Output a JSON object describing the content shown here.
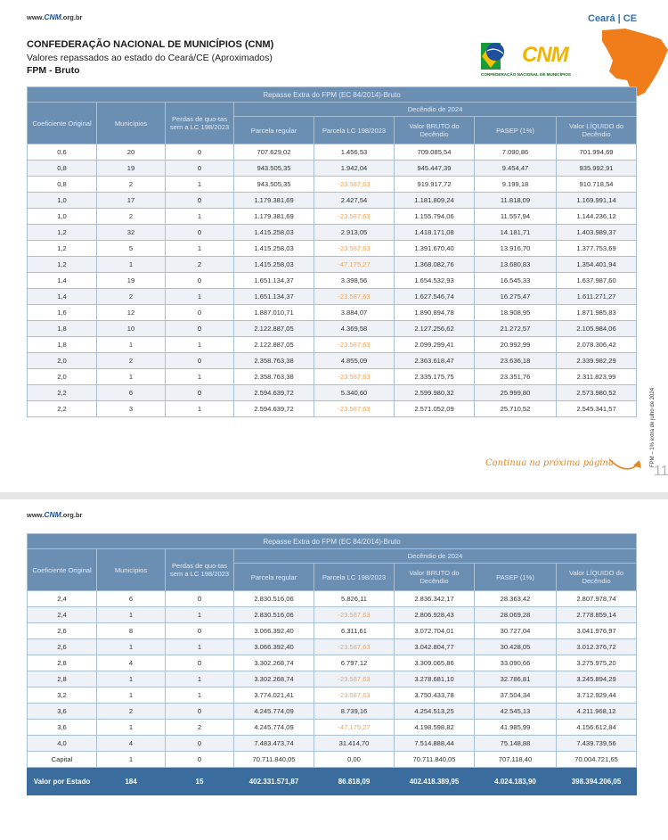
{
  "page1": {
    "site": "www.CNM.org.br",
    "state_label": "Ceará | CE",
    "title": "CONFEDERAÇÃO NACIONAL DE MUNICÍPIOS (CNM)",
    "subtitle": "Valores repassados ao estado do Ceará/CE (Aproximados)",
    "subtitle2": "FPM - Bruto",
    "logo_text": "CNM",
    "logo_sub": "CONFEDERAÇÃO NACIONAL DE MUNICÍPIOS",
    "continue_text": "Continua na próxima página",
    "page_number": "11",
    "side_text": "FPM – 1% extra de julho de 2024"
  },
  "page2": {
    "site": "www.CNM.org.br"
  },
  "table": {
    "caption": "Repasse Extra do FPM (EC 84/2014)-Bruto",
    "group_header": "Decêndio de 2024",
    "headers": {
      "coef": "Coeficiente Original",
      "mun": "Municípios",
      "perdas": "Perdas de quo-tas sem a LC 198/2023",
      "regular": "Parcela regular",
      "lc": "Parcela LC 198/2023",
      "bruto": "Valor BRUTO do Decêndio",
      "pasep": "PASEP (1%)",
      "liquido": "Valor LÍQUIDO do Decêndio"
    }
  },
  "rows1": [
    [
      "0,6",
      "20",
      "0",
      "707.629,02",
      "1.456,53",
      "709.085,54",
      "7.090,86",
      "701.994,69"
    ],
    [
      "0,8",
      "19",
      "0",
      "943.505,35",
      "1.942,04",
      "945.447,39",
      "9.454,47",
      "935.992,91"
    ],
    [
      "0,8",
      "2",
      "1",
      "943.505,35",
      "-23.587,63",
      "919.917,72",
      "9.199,18",
      "910.718,54"
    ],
    [
      "1,0",
      "17",
      "0",
      "1.179.381,69",
      "2.427,54",
      "1.181.809,24",
      "11.818,09",
      "1.169.991,14"
    ],
    [
      "1,0",
      "2",
      "1",
      "1.179.381,69",
      "-23.587,63",
      "1.155.794,06",
      "11.557,94",
      "1.144.236,12"
    ],
    [
      "1,2",
      "32",
      "0",
      "1.415.258,03",
      "2.913,05",
      "1.418.171,08",
      "14.181,71",
      "1.403.989,37"
    ],
    [
      "1,2",
      "5",
      "1",
      "1.415.258,03",
      "-23.587,63",
      "1.391.670,40",
      "13.916,70",
      "1.377.753,69"
    ],
    [
      "1,2",
      "1",
      "2",
      "1.415.258,03",
      "-47.175,27",
      "1.368.082,76",
      "13.680,83",
      "1.354.401,94"
    ],
    [
      "1,4",
      "19",
      "0",
      "1.651.134,37",
      "3.398,56",
      "1.654.532,93",
      "16.545,33",
      "1.637.987,60"
    ],
    [
      "1,4",
      "2",
      "1",
      "1.651.134,37",
      "-23.587,63",
      "1.627.546,74",
      "16.275,47",
      "1.611.271,27"
    ],
    [
      "1,6",
      "12",
      "0",
      "1.887.010,71",
      "3.884,07",
      "1.890.894,78",
      "18.908,95",
      "1.871.985,83"
    ],
    [
      "1,8",
      "10",
      "0",
      "2.122.887,05",
      "4.369,58",
      "2.127.256,62",
      "21.272,57",
      "2.105.984,06"
    ],
    [
      "1,8",
      "1",
      "1",
      "2.122.887,05",
      "-23.587,63",
      "2.099.299,41",
      "20.992,99",
      "2.078.306,42"
    ],
    [
      "2,0",
      "2",
      "0",
      "2.358.763,38",
      "4.855,09",
      "2.363.618,47",
      "23.636,18",
      "2.339.982,29"
    ],
    [
      "2,0",
      "1",
      "1",
      "2.358.763,38",
      "-23.587,63",
      "2.335.175,75",
      "23.351,76",
      "2.311.823,99"
    ],
    [
      "2,2",
      "6",
      "0",
      "2.594.639,72",
      "5.340,60",
      "2.599.980,32",
      "25.999,80",
      "2.573.980,52"
    ],
    [
      "2,2",
      "3",
      "1",
      "2.594.639,72",
      "-23.587,63",
      "2.571.052,09",
      "25.710,52",
      "2.545.341,57"
    ]
  ],
  "rows2": [
    [
      "2,4",
      "6",
      "0",
      "2.830.516,06",
      "5.826,11",
      "2.836.342,17",
      "28.363,42",
      "2.807.978,74"
    ],
    [
      "2,4",
      "1",
      "1",
      "2.830.516,06",
      "-23.587,63",
      "2.806.928,43",
      "28.069,28",
      "2.778.859,14"
    ],
    [
      "2,6",
      "8",
      "0",
      "3.066.392,40",
      "6.311,61",
      "3.072.704,01",
      "30.727,04",
      "3.041.976,97"
    ],
    [
      "2,6",
      "1",
      "1",
      "3.066.392,40",
      "-23.587,63",
      "3.042.804,77",
      "30.428,05",
      "3.012.376,72"
    ],
    [
      "2,8",
      "4",
      "0",
      "3.302.268,74",
      "6.797,12",
      "3.309.065,86",
      "33.090,66",
      "3.275.975,20"
    ],
    [
      "2,8",
      "1",
      "1",
      "3.302.268,74",
      "-23.587,63",
      "3.278.681,10",
      "32.786,81",
      "3.245.894,29"
    ],
    [
      "3,2",
      "1",
      "1",
      "3.774.021,41",
      "-23.587,63",
      "3.750.433,78",
      "37.504,34",
      "3.712.929,44"
    ],
    [
      "3,6",
      "2",
      "0",
      "4.245.774,09",
      "8.739,16",
      "4.254.513,25",
      "42.545,13",
      "4.211.968,12"
    ],
    [
      "3,6",
      "1",
      "2",
      "4.245.774,09",
      "-47.175,27",
      "4.198.598,82",
      "41.985,99",
      "4.156.612,84"
    ],
    [
      "4,0",
      "4",
      "0",
      "7.483.473,74",
      "31.414,70",
      "7.514.888,44",
      "75.148,88",
      "7.439.739,56"
    ],
    [
      "Capital",
      "1",
      "0",
      "70.711.840,05",
      "0,00",
      "70.711.840,05",
      "707.118,40",
      "70.004.721,65"
    ]
  ],
  "total": [
    "Valor por Estado",
    "184",
    "15",
    "402.331.571,87",
    "86.818,09",
    "402.418.389,95",
    "4.024.183,90",
    "398.394.206,05"
  ],
  "colors": {
    "header": "#6b8eb3",
    "total": "#3a6d9e",
    "negative": "#f0a560",
    "accent": "#e8861d"
  }
}
